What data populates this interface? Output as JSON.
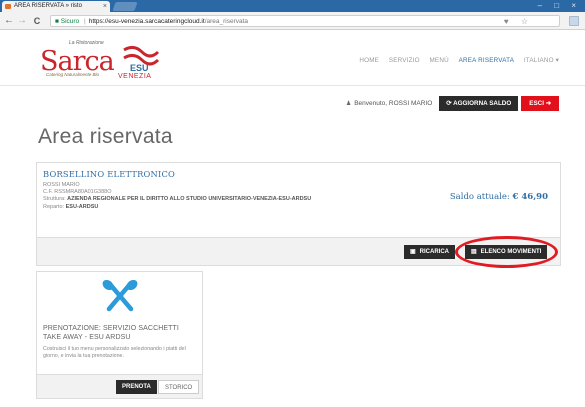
{
  "browser": {
    "tab_title": "AREA RISERVATA » risto",
    "tab_close": "×",
    "window_controls": "– □ ×",
    "nav": {
      "back": "←",
      "forward": "→",
      "reload": "C"
    },
    "secure_label": "Sicuro",
    "url_host": "https://esu-venezia.sarcacateringcloud.it",
    "url_path": "/area_riservata",
    "url_icons": "♥ ☆"
  },
  "brand": {
    "logo_main": "Sarca",
    "logo_top": "La Ristorazione",
    "logo_sub": "Catering Naturalmente Bio",
    "logo_venezia": "VENEZIA",
    "logo_esu": "ESU"
  },
  "nav": {
    "items": [
      {
        "label": "HOME",
        "active": false
      },
      {
        "label": "SERVIZIO",
        "active": false
      },
      {
        "label": "MENÙ",
        "active": false
      },
      {
        "label": "AREA RISERVATA",
        "active": true
      },
      {
        "label": "ITALIANO ▾",
        "active": false
      }
    ]
  },
  "userbar": {
    "welcome": "Benvenuto, ROSSI MARIO",
    "refresh_label": "AGGIORNA SALDO",
    "logout_label": "ESCI"
  },
  "page": {
    "title": "Area riservata"
  },
  "wallet": {
    "title": "BORSELLINO ELETTRONICO",
    "name": "ROSSI MARIO",
    "cf": "C.F. RSSMRA80A01G388O",
    "struttura_label": "Struttura:",
    "struttura_value": "AZIENDA REGIONALE PER IL DIRITTO ALLO STUDIO UNIVERSITARIO-VENEZIA-ESU-ARDSU",
    "reparto_label": "Reparto:",
    "reparto_value": "ESU-ARDSU",
    "saldo_label": "Saldo attuale:",
    "saldo_value": "€ 46,90",
    "ricarica_label": "RICARICA",
    "movimenti_label": "ELENCO MOVIMENTI"
  },
  "card": {
    "title": "PRENOTAZIONE: SERVIZIO SACCHETTI TAKE AWAY - ESU ARDSU",
    "description": "Costruisci il tuo menu personalizzato selezionando i piatti del giorno, e invia la tua prenotazione.",
    "prenota_label": "PRENOTA",
    "storico_label": "STORICO"
  },
  "colors": {
    "accent": "#2f6ea5",
    "brand_red": "#c8262c",
    "button_dark": "#2b2b2b",
    "button_red": "#e1101b",
    "highlight": "#e01b22",
    "icon_blue": "#2b9bd9"
  }
}
